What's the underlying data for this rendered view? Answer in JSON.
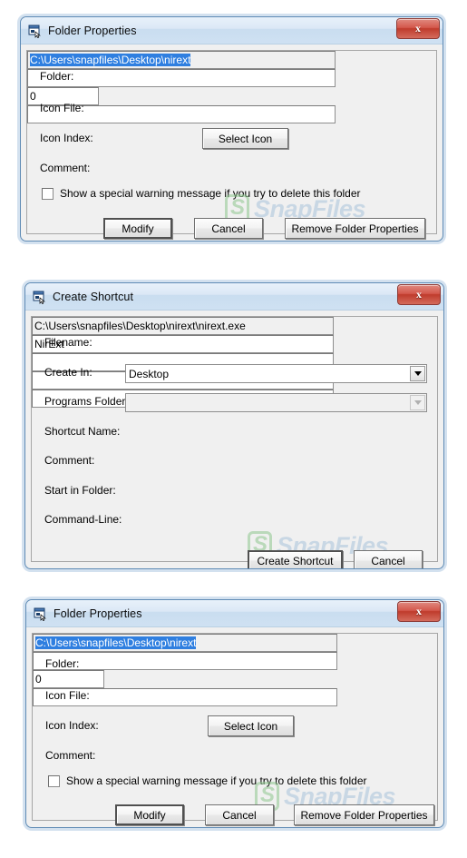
{
  "page": {
    "background": "#ffffff",
    "watermark": {
      "badge": "S",
      "text": "SnapFiles",
      "badge_color": "#8fc78f",
      "text_color": "#a9c3dc"
    }
  },
  "theme": {
    "titlebar_gradient_top": "#e8f1fa",
    "titlebar_gradient_bottom": "#cfe1f2",
    "window_border": "#5f8bb5",
    "client_bg": "#f0f0f0",
    "close_button_red": "#bf3b2c",
    "selection_blue": "#2f7fe0"
  },
  "dialogs": [
    {
      "id": "folder-properties-top",
      "title": "Folder Properties",
      "icon": "nirext-window-icon",
      "close_label": "x",
      "fields": [
        {
          "label": "Folder:",
          "value": "C:\\Users\\snapfiles\\Desktop\\nirext",
          "selected": true,
          "placeholder": ""
        },
        {
          "label": "Icon File:",
          "value": "",
          "selected": false,
          "placeholder": ""
        },
        {
          "label": "Icon Index:",
          "value": "0",
          "selected": false,
          "placeholder": ""
        },
        {
          "label": "Comment:",
          "value": "",
          "selected": false,
          "placeholder": ""
        }
      ],
      "select_icon_button": "Select Icon",
      "checkbox": {
        "label": "Show a special warning message if you try to delete this folder",
        "checked": false
      },
      "buttons": [
        {
          "label": "Modify",
          "default": true
        },
        {
          "label": "Cancel",
          "default": false
        },
        {
          "label": "Remove Folder Properties",
          "default": false
        }
      ]
    },
    {
      "id": "create-shortcut",
      "title": "Create Shortcut",
      "icon": "nirext-window-icon",
      "close_label": "x",
      "fields": [
        {
          "label": "Filename:",
          "value": "C:\\Users\\snapfiles\\Desktop\\nirext\\nirext.exe",
          "kind": "text-readonly",
          "placeholder": ""
        },
        {
          "label": "Create In:",
          "value": "Desktop",
          "kind": "combo",
          "disabled": false,
          "placeholder": ""
        },
        {
          "label": "Programs Folder:",
          "value": "",
          "kind": "combo",
          "disabled": true,
          "placeholder": ""
        },
        {
          "label": "Shortcut Name:",
          "value": "NirExt",
          "kind": "text",
          "placeholder": ""
        },
        {
          "label": "Comment:",
          "value": "",
          "kind": "text",
          "placeholder": ""
        },
        {
          "label": "Start in Folder:",
          "value": "",
          "kind": "text",
          "placeholder": ""
        },
        {
          "label": "Command-Line:",
          "value": "",
          "kind": "text",
          "placeholder": ""
        }
      ],
      "buttons": [
        {
          "label": "Create Shortcut",
          "default": true
        },
        {
          "label": "Cancel",
          "default": false
        }
      ]
    },
    {
      "id": "folder-properties-bottom",
      "title": "Folder Properties",
      "icon": "nirext-window-icon",
      "close_label": "x",
      "fields": [
        {
          "label": "Folder:",
          "value": "C:\\Users\\snapfiles\\Desktop\\nirext",
          "selected": true,
          "placeholder": ""
        },
        {
          "label": "Icon File:",
          "value": "",
          "selected": false,
          "placeholder": ""
        },
        {
          "label": "Icon Index:",
          "value": "0",
          "selected": false,
          "placeholder": ""
        },
        {
          "label": "Comment:",
          "value": "",
          "selected": false,
          "placeholder": ""
        }
      ],
      "select_icon_button": "Select Icon",
      "checkbox": {
        "label": "Show a special warning message if you try to delete this folder",
        "checked": false
      },
      "buttons": [
        {
          "label": "Modify",
          "default": true
        },
        {
          "label": "Cancel",
          "default": false
        },
        {
          "label": "Remove Folder Properties",
          "default": false
        }
      ]
    }
  ]
}
